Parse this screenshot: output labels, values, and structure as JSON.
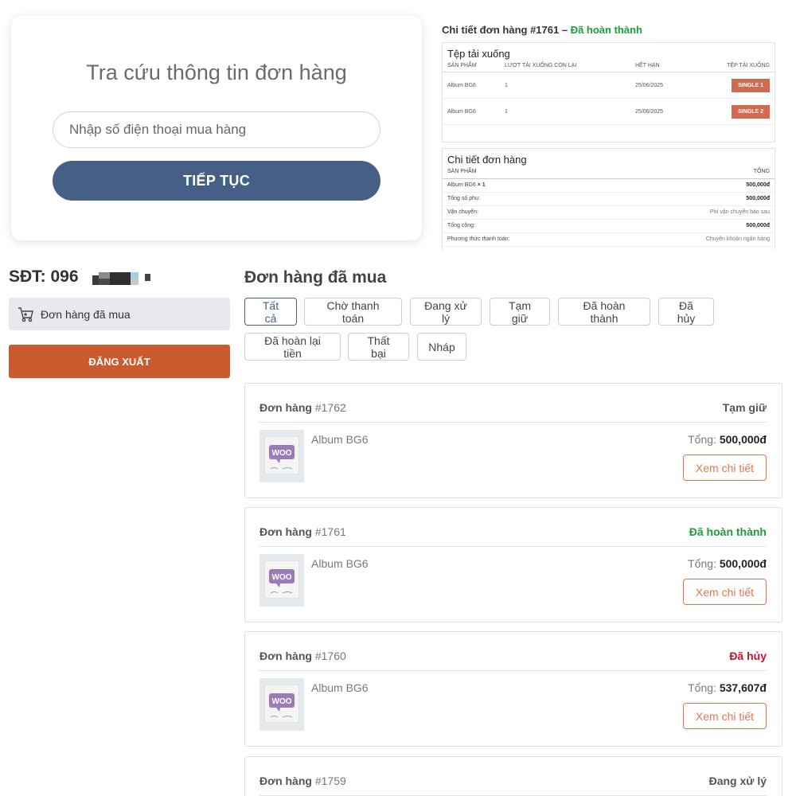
{
  "lookup": {
    "title": "Tra cứu thông tin đơn hàng",
    "phone_placeholder": "Nhập số điện thoại mua hàng",
    "continue_label": "TIẾP TỤC"
  },
  "order_detail": {
    "heading_prefix": "Chi tiết đơn hàng #1761 –",
    "heading_status": "Đã hoàn thành",
    "colors": {
      "completed": "#1f9d3a"
    },
    "downloads": {
      "title": "Tệp tải xuống",
      "columns": [
        "SẢN PHẨM",
        "LƯỢT TẢI XUỐNG CÒN LẠI",
        "HẾT HẠN",
        "TỆP TẢI XUỐNG"
      ],
      "rows": [
        {
          "product": "Album BG6",
          "remaining": "1",
          "expires": "25/06/2025",
          "file": "SINGLE 1"
        },
        {
          "product": "Album BG6",
          "remaining": "1",
          "expires": "25/06/2025",
          "file": "SINGLE 2"
        }
      ]
    },
    "summary": {
      "title": "Chi tiết đơn hàng",
      "col_product": "SẢN PHẨM",
      "col_total": "TỔNG",
      "item": {
        "name": "Album BG6",
        "qty": "× 1",
        "value": "500,000đ"
      },
      "rows": [
        {
          "label": "Tổng số phụ:",
          "value": "500,000đ",
          "bold": true
        },
        {
          "label": "Vận chuyển:",
          "value": "Phí vận chuyển báo sau",
          "bold": false
        },
        {
          "label": "Tổng cộng:",
          "value": "500,000đ",
          "bold": true
        },
        {
          "label": "Phương thức thanh toán:",
          "value": "Chuyển khoản ngân hàng",
          "bold": false
        }
      ]
    }
  },
  "account": {
    "phone_label": "SĐT: 096",
    "menu_item": "Đơn hàng đã mua",
    "logout_label": "ĐĂNG XUẤT",
    "logout_color": "#cc5a2f"
  },
  "orders": {
    "title": "Đơn hàng đã mua",
    "filters": [
      "Tất cả",
      "Chờ thanh toán",
      "Đang xử lý",
      "Tạm giữ",
      "Đã hoàn thành",
      "Đã hủy",
      "Đã hoàn lại tiền",
      "Thất bại",
      "Nháp"
    ],
    "active_filter": "Tất cả",
    "order_label": "Đơn hàng",
    "total_label": "Tổng:",
    "view_label": "Xem chi tiết",
    "list": [
      {
        "number": "#1762",
        "status": "Tạm giữ",
        "status_color": "#555555",
        "product": "Album BG6",
        "total": "500,000đ"
      },
      {
        "number": "#1761",
        "status": "Đã hoàn thành",
        "status_color": "#1f9d3a",
        "product": "Album BG6",
        "total": "500,000đ"
      },
      {
        "number": "#1760",
        "status": "Đã hủy",
        "status_color": "#c8102e",
        "product": "Album BG6",
        "total": "537,607đ"
      },
      {
        "number": "#1759",
        "status": "Đang xử lý",
        "status_color": "#555555"
      }
    ]
  }
}
